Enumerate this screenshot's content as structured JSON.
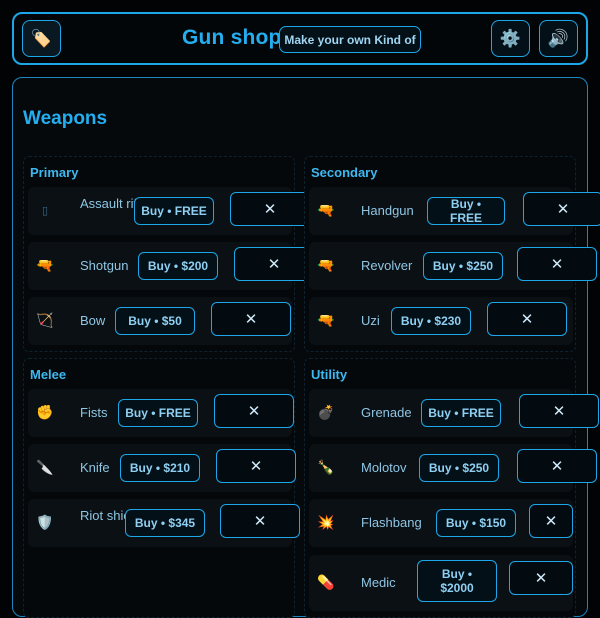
{
  "header": {
    "title": "Gun shop",
    "make_button": "Make your own Kind of",
    "icons": {
      "left": "tag-icon",
      "settings": "gear-icon",
      "sound": "speaker-icon"
    }
  },
  "panel": {
    "title": "Weapons",
    "sections": {
      "primary": {
        "title": "Primary",
        "items": [
          {
            "name": "Assault rifle",
            "buy": "Buy • FREE",
            "icon": "rifle-icon"
          },
          {
            "name": "Shotgun",
            "buy": "Buy • $200",
            "icon": "gun-icon"
          },
          {
            "name": "Bow",
            "buy": "Buy • $50",
            "icon": "bow-icon"
          }
        ]
      },
      "secondary": {
        "title": "Secondary",
        "items": [
          {
            "name": "Handgun",
            "buy": "Buy • FREE",
            "icon": "gun-icon"
          },
          {
            "name": "Revolver",
            "buy": "Buy • $250",
            "icon": "gun-icon"
          },
          {
            "name": "Uzi",
            "buy": "Buy • $230",
            "icon": "gun-icon"
          }
        ]
      },
      "melee": {
        "title": "Melee",
        "items": [
          {
            "name": "Fists",
            "buy": "Buy • FREE",
            "icon": "fist-icon"
          },
          {
            "name": "Knife",
            "buy": "Buy • $210",
            "icon": "knife-icon"
          },
          {
            "name": "Riot shield",
            "buy": "Buy • $345",
            "icon": "shield-icon"
          }
        ]
      },
      "utility": {
        "title": "Utility",
        "items": [
          {
            "name": "Grenade",
            "buy": "Buy • FREE",
            "icon": "bomb-icon"
          },
          {
            "name": "Molotov",
            "buy": "Buy • $250",
            "icon": "molotov-icon"
          },
          {
            "name": "Flashbang",
            "buy": "Buy • $150",
            "icon": "explosion-icon"
          },
          {
            "name": "Medic",
            "buy": "Buy • $2000",
            "icon": "pill-icon"
          }
        ]
      }
    }
  },
  "close_symbol": "✕",
  "colors": {
    "accent": "#1da7e8",
    "title": "#24aef0",
    "background": "#020304"
  }
}
